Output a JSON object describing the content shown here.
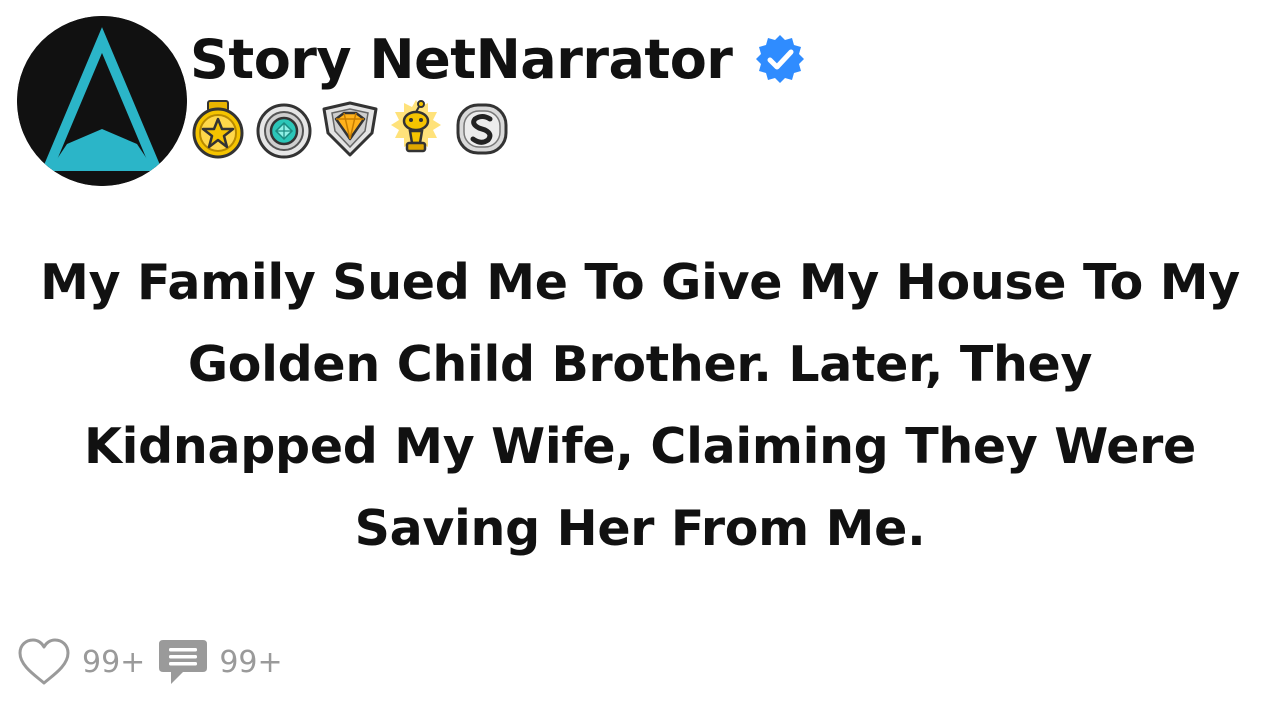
{
  "post": {
    "author": {
      "username": "Story NetNarrator",
      "verified_icon": "verified-check-icon",
      "avatar_icon": "triangle-logo-icon",
      "avatar_colors": {
        "background": "#111111",
        "accent": "#2bb5c8"
      }
    },
    "badges": [
      {
        "icon": "gold-star-medal-icon"
      },
      {
        "icon": "teal-gem-medal-icon"
      },
      {
        "icon": "gold-diamond-shield-medal-icon"
      },
      {
        "icon": "golden-trophy-snoo-icon"
      },
      {
        "icon": "silver-s-medal-icon"
      }
    ],
    "title": "My Family Sued Me To Give My House To My Golden Child Brother. Later, They Kidnapped My Wife, Claiming They Were Saving Her From Me.",
    "stats": {
      "likes": "99+",
      "comments": "99+"
    }
  },
  "colors": {
    "text": "#111111",
    "muted": "#9a9a9a",
    "verified": "#2f8cff"
  }
}
